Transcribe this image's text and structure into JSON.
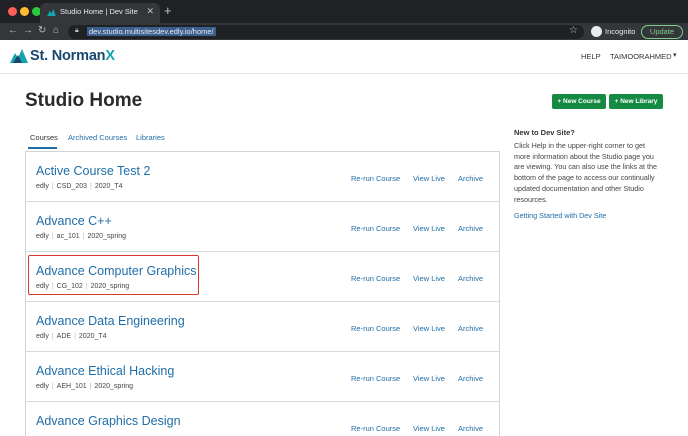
{
  "browser": {
    "tab_title": "Studio Home | Dev Site",
    "url": "dev.studio.multisitesdev.edly.io/home/",
    "incognito_label": "Incognito",
    "update_label": "Update"
  },
  "header": {
    "logo_main": "St. Norman",
    "logo_accent": "X",
    "help_label": "HELP",
    "user_label": "TAIMOORAHMED"
  },
  "page": {
    "title": "Studio Home",
    "new_course_label": "New Course",
    "new_library_label": "New Library"
  },
  "tabs": {
    "courses": "Courses",
    "archived": "Archived Courses",
    "libraries": "Libraries"
  },
  "courses": [
    {
      "name": "Active Course Test 2",
      "org": "edly",
      "number": "CSD_203",
      "run": "2020_T4"
    },
    {
      "name": "Advance C++",
      "org": "edly",
      "number": "ac_101",
      "run": "2020_spring"
    },
    {
      "name": "Advance Computer Graphics",
      "org": "edly",
      "number": "CG_102",
      "run": "2020_spring"
    },
    {
      "name": "Advance Data Engineering",
      "org": "edly",
      "number": "ADE",
      "run": "2020_T4"
    },
    {
      "name": "Advance Ethical Hacking",
      "org": "edly",
      "number": "AEH_101",
      "run": "2020_spring"
    },
    {
      "name": "Advance Graphics Design",
      "org": "",
      "number": "",
      "run": ""
    }
  ],
  "actions": {
    "rerun": "Re-run Course",
    "view_live": "View Live",
    "archive": "Archive"
  },
  "sidebar": {
    "heading": "New to Dev Site?",
    "body": "Click Help in the upper-right corner to get more information about the Studio page you are viewing. You can also use the links at the bottom of the page to access our continually updated documentation and other Studio resources.",
    "link": "Getting Started with Dev Site"
  },
  "colors": {
    "link_blue": "#1f6ea8",
    "button_green": "#158a43",
    "highlight_red": "#d9382b",
    "brand_navy": "#18466d",
    "brand_teal": "#15a4ad"
  }
}
